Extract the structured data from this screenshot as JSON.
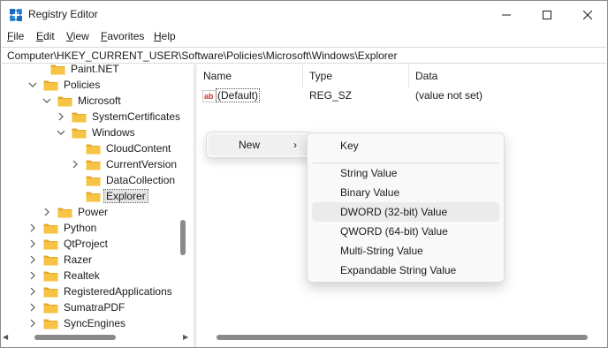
{
  "window": {
    "title": "Registry Editor"
  },
  "menu": [
    {
      "label": "File",
      "u": "F",
      "rest": "ile"
    },
    {
      "label": "Edit",
      "u": "E",
      "rest": "dit"
    },
    {
      "label": "View",
      "u": "V",
      "rest": "iew"
    },
    {
      "label": "Favorites",
      "u": "F",
      "rest": "avorites",
      "pre": "Fa"
    },
    {
      "label": "Help",
      "u": "H",
      "rest": "elp"
    }
  ],
  "address": "Computer\\HKEY_CURRENT_USER\\Software\\Policies\\Microsoft\\Windows\\Explorer",
  "tree": [
    {
      "label": "Paint.NET",
      "chev": "none"
    },
    {
      "label": "Policies",
      "chev": "down"
    },
    {
      "label": "Microsoft",
      "chev": "down"
    },
    {
      "label": "SystemCertificates",
      "chev": "right"
    },
    {
      "label": "Windows",
      "chev": "down"
    },
    {
      "label": "CloudContent",
      "chev": "none"
    },
    {
      "label": "CurrentVersion",
      "chev": "right"
    },
    {
      "label": "DataCollection",
      "chev": "none"
    },
    {
      "label": "Explorer",
      "chev": "none",
      "selected": true
    },
    {
      "label": "Power",
      "chev": "right"
    },
    {
      "label": "Python",
      "chev": "right"
    },
    {
      "label": "QtProject",
      "chev": "right"
    },
    {
      "label": "Razer",
      "chev": "right"
    },
    {
      "label": "Realtek",
      "chev": "right"
    },
    {
      "label": "RegisteredApplications",
      "chev": "right"
    },
    {
      "label": "SumatraPDF",
      "chev": "right"
    },
    {
      "label": "SyncEngines",
      "chev": "right"
    }
  ],
  "columns": {
    "name": "Name",
    "type": "Type",
    "data": "Data"
  },
  "values": [
    {
      "name": "(Default)",
      "type": "REG_SZ",
      "data": "(value not set)",
      "icon": "ab-string-icon"
    }
  ],
  "context_menu": {
    "new_label": "New",
    "arrow": "›"
  },
  "submenu": {
    "key": "Key",
    "items": [
      "String Value",
      "Binary Value",
      "DWORD (32-bit) Value",
      "QWORD (64-bit) Value",
      "Multi-String Value",
      "Expandable String Value"
    ],
    "hovered_index": 2
  },
  "colors": {
    "folder": "#f6c342",
    "folder_dark": "#e3a929",
    "accent": "#0a64d8",
    "ab_red": "#c0392b"
  }
}
